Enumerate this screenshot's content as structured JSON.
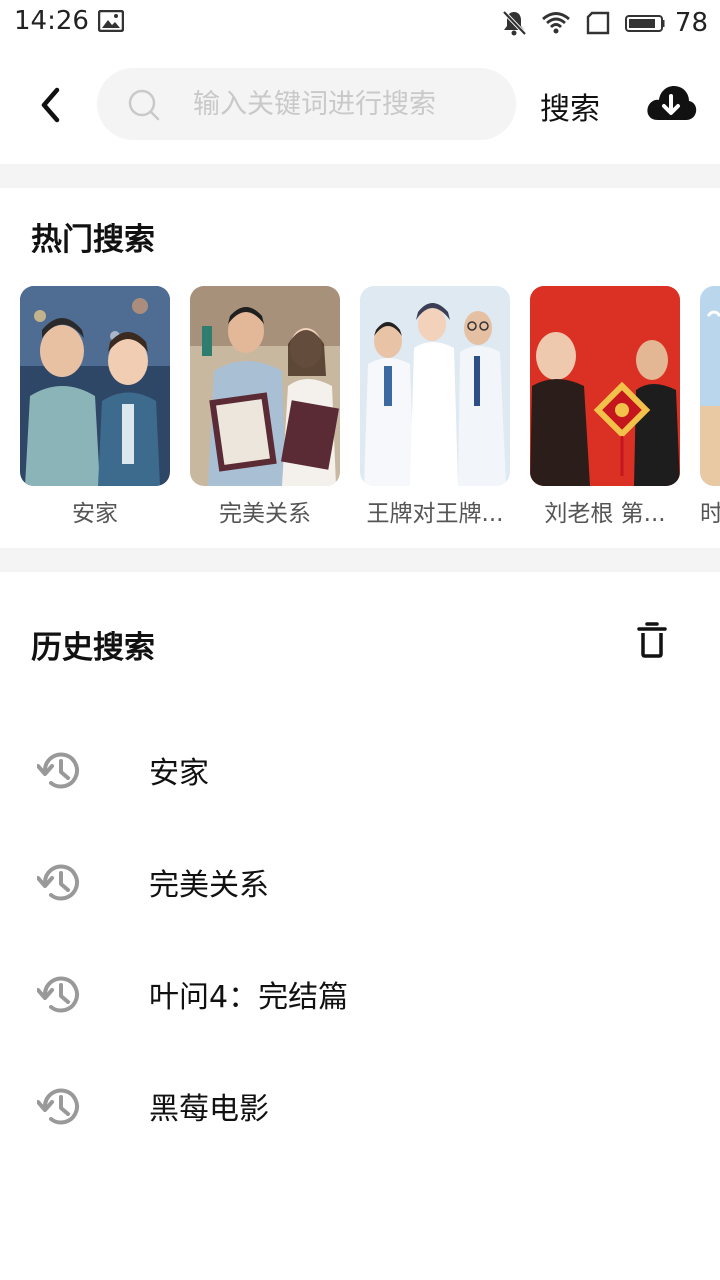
{
  "status_bar": {
    "time": "14:26",
    "battery": "78",
    "icons": [
      "image-icon",
      "bell-muted-icon",
      "wifi-icon",
      "sim-icon",
      "battery-icon"
    ]
  },
  "search": {
    "placeholder": "输入关键词进行搜索",
    "value": "",
    "button_label": "搜索",
    "icons": [
      "back-arrow-icon",
      "search-icon",
      "cloud-download-icon"
    ]
  },
  "hot_search": {
    "title": "热门搜索",
    "items": [
      {
        "label": "安家"
      },
      {
        "label": "完美关系"
      },
      {
        "label": "王牌对王牌..."
      },
      {
        "label": "刘老根 第..."
      },
      {
        "label": "时"
      }
    ]
  },
  "history": {
    "title": "历史搜索",
    "clear_icon": "trash-icon",
    "items": [
      {
        "label": "安家"
      },
      {
        "label": "完美关系"
      },
      {
        "label": "叶问4：完结篇"
      },
      {
        "label": "黑莓电影"
      }
    ]
  },
  "colors": {
    "background": "#ffffff",
    "divider": "#f4f4f4",
    "search_bg": "#f4f4f4",
    "placeholder": "#c9c9c9",
    "history_icon": "#999999"
  }
}
